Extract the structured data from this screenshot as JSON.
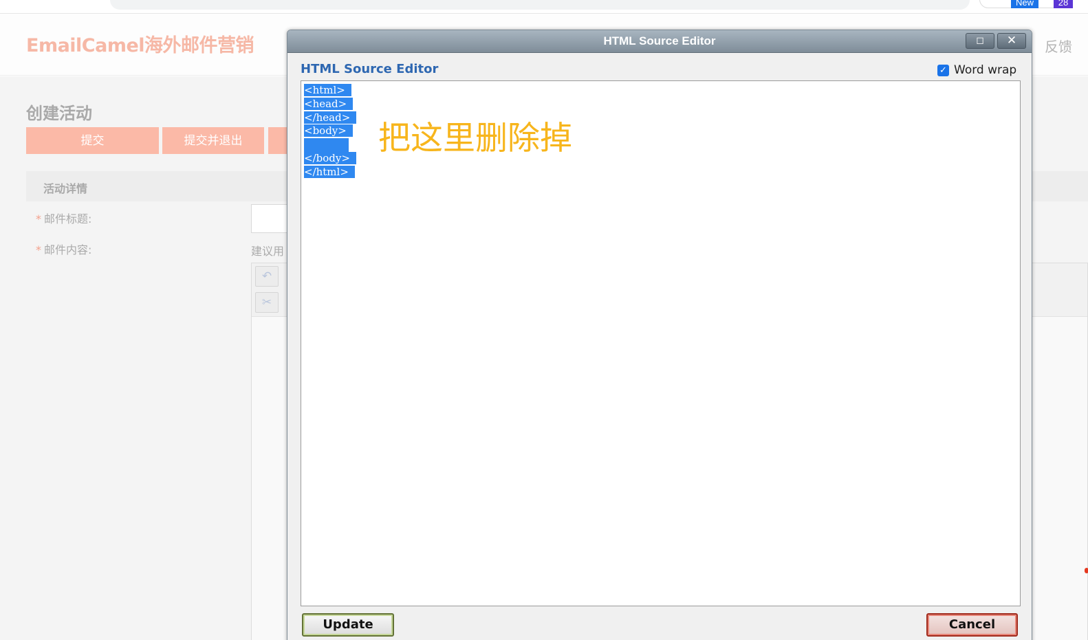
{
  "browser": {
    "new_badge": "New",
    "count_badge": "28"
  },
  "site": {
    "logo": "EmailCamel海外邮件营销",
    "feedback": "反馈"
  },
  "page": {
    "title": "创建活动",
    "buttons": {
      "submit": "提交",
      "submit_exit": "提交并退出"
    },
    "details_title": "活动详情",
    "fields": {
      "subject_label": "邮件标题:",
      "content_label": "邮件内容:",
      "required_mark": "*",
      "hint": "建议用"
    },
    "toolbar_icons": [
      "undo-icon",
      "cut-icon"
    ]
  },
  "dialog": {
    "title": "HTML Source Editor",
    "heading": "HTML Source Editor",
    "word_wrap_label": "Word wrap",
    "word_wrap_checked": true,
    "code_lines": [
      "<html>",
      "<head>",
      "</head>",
      "<body>",
      "",
      "</body>",
      "</html>"
    ],
    "annotation": "把这里删除掉",
    "annotation_color": "#f7b51c",
    "selection_color": "#2f88f0",
    "update_label": "Update",
    "cancel_label": "Cancel"
  }
}
